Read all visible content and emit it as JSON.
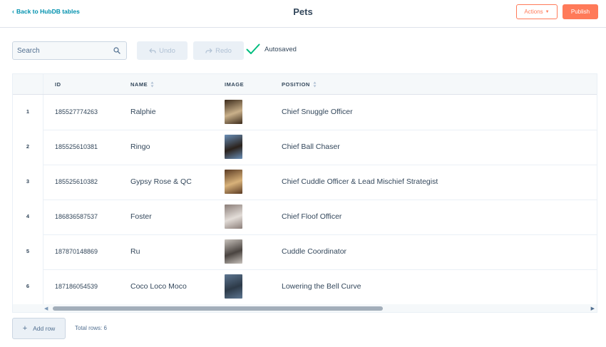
{
  "header": {
    "back_label": "Back to HubDB tables",
    "title": "Pets",
    "actions_label": "Actions",
    "publish_label": "Publish"
  },
  "toolbar": {
    "search_placeholder": "Search",
    "undo_label": "Undo",
    "redo_label": "Redo",
    "autosaved_label": "Autosaved"
  },
  "table": {
    "columns": [
      "ID",
      "NAME",
      "IMAGE",
      "POSITION"
    ],
    "rows": [
      {
        "num": "1",
        "id": "185527774263",
        "name": "Ralphie",
        "position": "Chief Snuggle Officer",
        "img": [
          "#3b2a1a",
          "#c9b08a"
        ]
      },
      {
        "num": "2",
        "id": "185525610381",
        "name": "Ringo",
        "position": "Chief Ball Chaser",
        "img": [
          "#6a8fb8",
          "#2b221c"
        ]
      },
      {
        "num": "3",
        "id": "185525610382",
        "name": "Gypsy Rose & QC",
        "position": "Chief Cuddle Officer & Lead Mischief Strategist",
        "img": [
          "#5a3a22",
          "#d8b27a"
        ]
      },
      {
        "num": "4",
        "id": "186836587537",
        "name": "Foster",
        "position": "Chief Floof Officer",
        "img": [
          "#8a7d78",
          "#e3ddd8"
        ]
      },
      {
        "num": "5",
        "id": "187870148869",
        "name": "Ru",
        "position": "Cuddle Coordinator",
        "img": [
          "#c8c2bc",
          "#4a4440"
        ]
      },
      {
        "num": "6",
        "id": "187186054539",
        "name": "Coco Loco Moco",
        "position": "Lowering the Bell Curve",
        "img": [
          "#5d7691",
          "#2d3a48"
        ]
      }
    ]
  },
  "footer": {
    "add_row_label": "Add row",
    "total_rows_label": "Total rows: 6"
  },
  "colors": {
    "accent": "#ff7a59",
    "link": "#0091ae",
    "text": "#33475b",
    "success": "#00bd7e"
  },
  "icons": [
    "chevron-left-icon",
    "caret-down-icon",
    "search-icon",
    "undo-icon",
    "redo-icon",
    "checkmark-icon",
    "sort-icon",
    "plus-icon"
  ]
}
